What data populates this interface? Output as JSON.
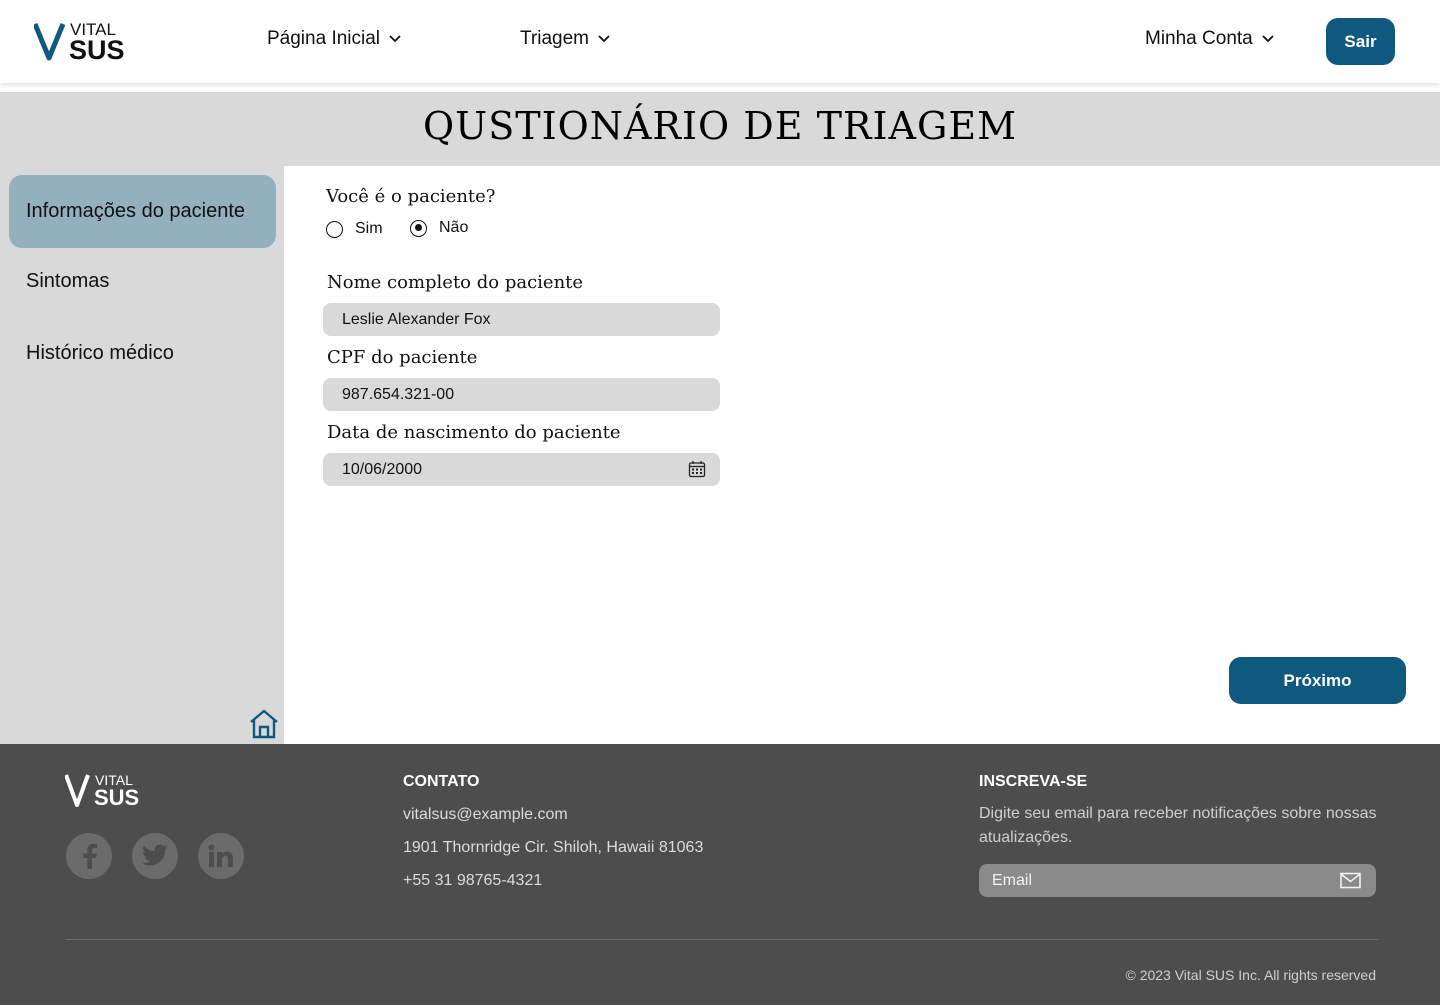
{
  "brand": {
    "logo_top": "VITAL",
    "logo_bottom": "SUS",
    "color_primary": "#0e5a7e",
    "color_sidebar_active": "#92b1bc"
  },
  "header": {
    "nav": [
      {
        "label": "Página Inicial",
        "icon": "chevron-down-icon"
      },
      {
        "label": "Triagem",
        "icon": "chevron-down-icon"
      }
    ],
    "account_label": "Minha Conta",
    "logout_label": "Sair"
  },
  "page": {
    "title": "QUSTIONÁRIO DE TRIAGEM"
  },
  "sidebar": {
    "items": [
      {
        "label": "Informações do paciente",
        "active": true
      },
      {
        "label": "Sintomas",
        "active": false
      },
      {
        "label": "Histórico médico",
        "active": false
      }
    ],
    "home_icon": "home-icon"
  },
  "form": {
    "is_patient_question": "Você é o paciente?",
    "options": [
      {
        "label": "Sim",
        "selected": false
      },
      {
        "label": "Não",
        "selected": true
      }
    ],
    "name_label": "Nome completo do paciente",
    "name_value": "Leslie Alexander Fox",
    "cpf_label": "CPF do paciente",
    "cpf_value": "987.654.321-00",
    "birth_label": "Data de nascimento do paciente",
    "birth_value": "10/06/2000",
    "next_label": "Próximo"
  },
  "footer": {
    "contact_title": "CONTATO",
    "email": "vitalsus@example.com",
    "address": "1901 Thornridge Cir. Shiloh, Hawaii 81063",
    "phone": "+55 31 98765-4321",
    "subscribe_title": "INSCREVA-SE",
    "subscribe_text": "Digite seu email para receber notificações sobre nossas atualizações.",
    "email_placeholder": "Email",
    "copyright": "© 2023 Vital SUS Inc. All rights reserved",
    "social": [
      "facebook-icon",
      "twitter-icon",
      "linkedin-icon"
    ]
  }
}
